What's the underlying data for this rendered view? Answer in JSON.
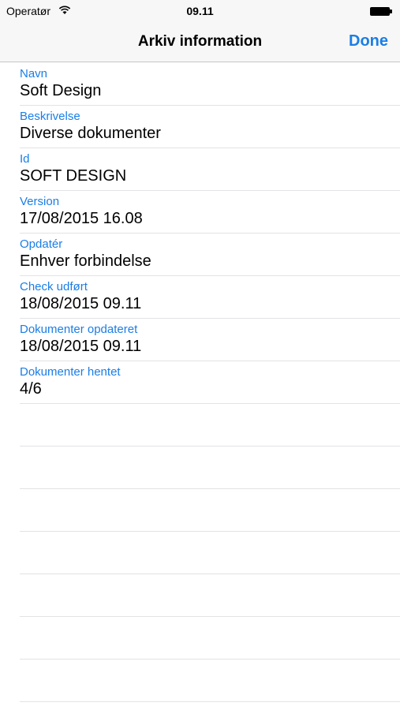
{
  "status_bar": {
    "carrier": "Operatør",
    "time": "09.11",
    "icons": [
      "wifi-icon",
      "battery-icon"
    ]
  },
  "nav": {
    "title": "Arkiv information",
    "done_label": "Done"
  },
  "accent_color": "#1a7ee6",
  "fields": [
    {
      "label": "Navn",
      "value": "Soft Design"
    },
    {
      "label": "Beskrivelse",
      "value": "Diverse dokumenter"
    },
    {
      "label": "Id",
      "value": "SOFT DESIGN"
    },
    {
      "label": "Version",
      "value": "17/08/2015 16.08"
    },
    {
      "label": "Opdatér",
      "value": "Enhver forbindelse"
    },
    {
      "label": "Check udført",
      "value": "18/08/2015 09.11"
    },
    {
      "label": "Dokumenter opdateret",
      "value": "18/08/2015 09.11"
    },
    {
      "label": "Dokumenter hentet",
      "value": "4/6"
    }
  ]
}
